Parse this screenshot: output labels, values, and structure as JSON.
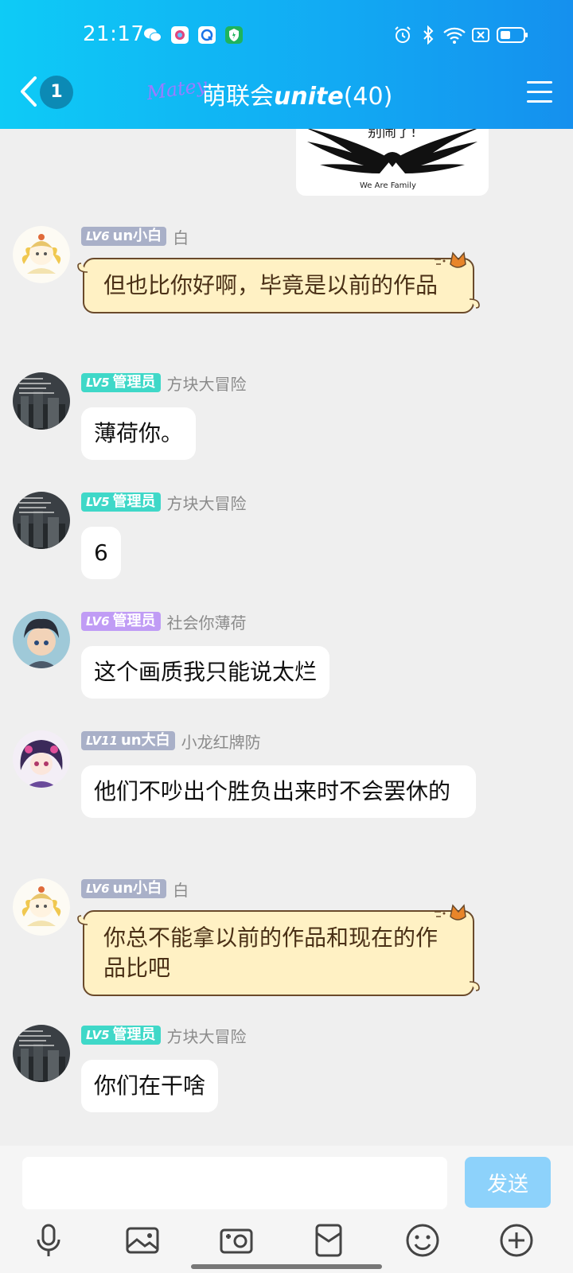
{
  "status_bar": {
    "time": "21:17"
  },
  "header": {
    "back_count": "1",
    "logo_text": "Matey",
    "title_prefix": "萌联会",
    "title_brand": "unite",
    "member_count": "(40)"
  },
  "image_message": {
    "caption": "别闹了!",
    "footer": "We Are Family"
  },
  "messages": [
    {
      "level": "LV6",
      "title": "un小白",
      "nick": "白",
      "text": "但也比你好啊，毕竟是以前的作品",
      "tag_color": "#a9b0c8",
      "style": "cat"
    },
    {
      "level": "LV5",
      "title": "管理员",
      "nick": "方块大冒险",
      "text": "薄荷你。",
      "tag_color": "#3fd8c8",
      "style": "plain"
    },
    {
      "level": "LV5",
      "title": "管理员",
      "nick": "方块大冒险",
      "text": "6",
      "tag_color": "#3fd8c8",
      "style": "plain"
    },
    {
      "level": "LV6",
      "title": "管理员",
      "nick": "社会你薄荷",
      "text": "这个画质我只能说太烂",
      "tag_color": "#c09cf5",
      "style": "plain"
    },
    {
      "level": "LV11",
      "title": "un大白",
      "nick": "小龙红牌防",
      "text": "他们不吵出个胜负出来时不会罢休的",
      "tag_color": "#a9b0c8",
      "style": "plain"
    },
    {
      "level": "LV6",
      "title": "un小白",
      "nick": "白",
      "text": "你总不能拿以前的作品和现在的作品比吧",
      "tag_color": "#a9b0c8",
      "style": "cat"
    },
    {
      "level": "LV5",
      "title": "管理员",
      "nick": "方块大冒险",
      "text": "你们在干啥",
      "tag_color": "#3fd8c8",
      "style": "plain"
    }
  ],
  "input": {
    "value": "",
    "send_label": "发送"
  },
  "toolbar_icons": [
    "microphone-icon",
    "image-icon",
    "camera-icon",
    "red-packet-icon",
    "emoji-icon",
    "plus-icon"
  ]
}
